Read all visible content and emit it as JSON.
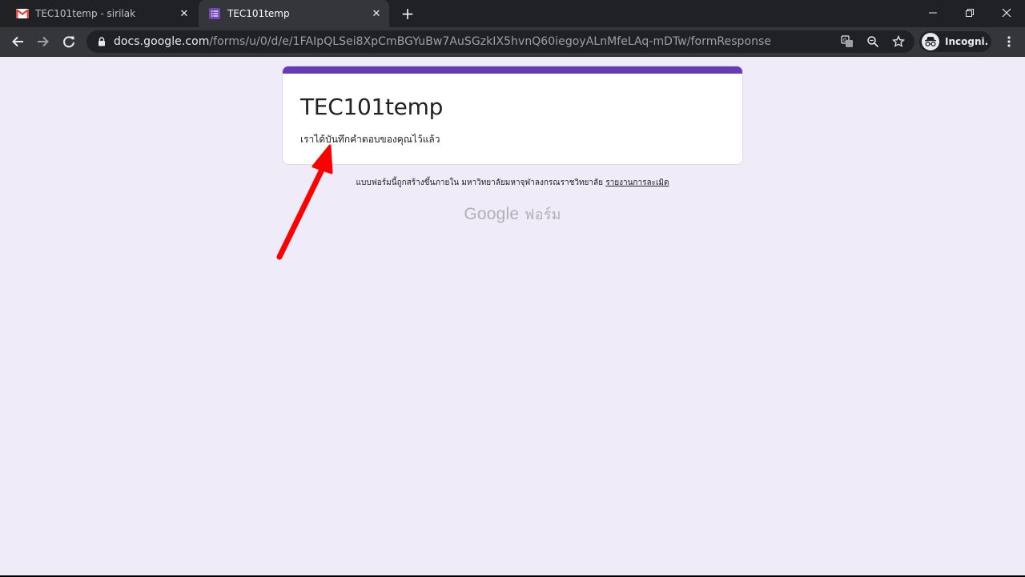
{
  "browser": {
    "tabs": [
      {
        "title": "TEC101temp - sirilak",
        "favicon": "gmail-icon",
        "active": false
      },
      {
        "title": "TEC101temp",
        "favicon": "google-forms-icon",
        "active": true
      }
    ],
    "new_tab_label": "+",
    "url_host": "docs.google.com",
    "url_path": "/forms/u/0/d/e/1FAIpQLSei8XpCmBGYuBw7AuSGzkIX5hvnQ60iegoyALnMfeLAq-mDTw/formResponse",
    "profile_label": "Incogni..."
  },
  "form": {
    "title": "TEC101temp",
    "confirmation": "เราได้บันทึกคำตอบของคุณไว้แล้ว",
    "footer_text": "แบบฟอร์มนี้ถูกสร้างขึ้นภายใน มหาวิทยาลัยมหาจุฬาลงกรณราชวิทยาลัย",
    "report_link": "รายงานการละเมิด",
    "brand_google": "Google",
    "brand_forms": "ฟอร์ม"
  },
  "colors": {
    "form_accent": "#673ab7",
    "page_background": "#efebf8",
    "annotation_arrow": "#ff0000"
  }
}
